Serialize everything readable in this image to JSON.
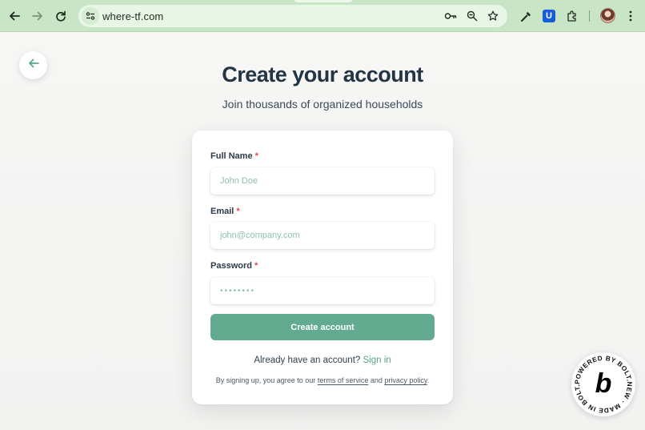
{
  "browser": {
    "url": "where-tf.com",
    "icons": [
      "back-arrow-icon",
      "forward-arrow-icon",
      "reload-icon",
      "site-info-icon",
      "key-icon",
      "zoom-icon",
      "star-icon",
      "eyedropper-icon",
      "bitwarden-icon",
      "extensions-icon",
      "profile-avatar",
      "more-vert-icon"
    ],
    "bitwarden_glyph": "U",
    "accent": "#c8e6c5"
  },
  "page": {
    "back_icon": "arrow-left-icon",
    "title": "Create your account",
    "subtitle": "Join thousands of organized households"
  },
  "form": {
    "full_name": {
      "label": "Full Name",
      "required_mark": "*",
      "placeholder": "John Doe",
      "value": ""
    },
    "email": {
      "label": "Email",
      "required_mark": "*",
      "placeholder": "john@company.com",
      "value": ""
    },
    "password": {
      "label": "Password",
      "required_mark": "*",
      "placeholder": "••••••••",
      "value": ""
    },
    "submit_label": "Create account",
    "primary_color": "#62aa90"
  },
  "footer": {
    "signin_prompt": "Already have an account?",
    "signin_link": "Sign in",
    "terms_prefix": "By signing up, you agree to our",
    "terms_link": "terms of service",
    "terms_and": "and",
    "privacy_link": "privacy policy",
    "terms_suffix": "."
  },
  "badge": {
    "ring_text": "POWERED BY BOLT.NEW · MADE IN BOLT.NEW ·",
    "glyph": "b"
  }
}
